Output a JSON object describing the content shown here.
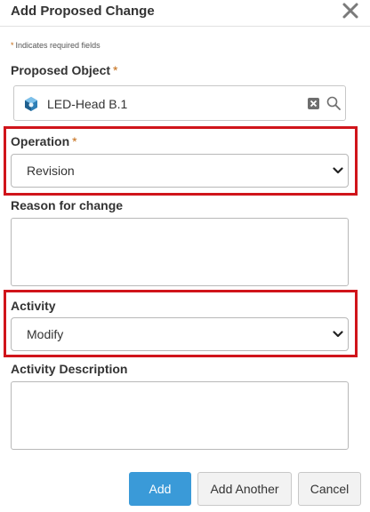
{
  "dialog": {
    "title": "Add Proposed Change"
  },
  "required_note": {
    "star": "*",
    "text": "Indicates required fields"
  },
  "proposed_object": {
    "label": "Proposed Object",
    "required_mark": "*",
    "value": "LED-Head B.1"
  },
  "operation": {
    "label": "Operation",
    "required_mark": "*",
    "selected": "Revision"
  },
  "reason": {
    "label": "Reason for change",
    "value": ""
  },
  "activity": {
    "label": "Activity",
    "selected": "Modify"
  },
  "activity_description": {
    "label": "Activity Description",
    "value": ""
  },
  "buttons": {
    "add": "Add",
    "add_another": "Add Another",
    "cancel": "Cancel"
  },
  "colors": {
    "primary": "#3a9ad8",
    "highlight": "#d0141b",
    "required": "#c46b13"
  },
  "icons": {
    "close": "close-icon",
    "object": "part-icon",
    "clear": "clear-icon",
    "search": "search-icon",
    "dropdown": "chevron-down-icon"
  }
}
